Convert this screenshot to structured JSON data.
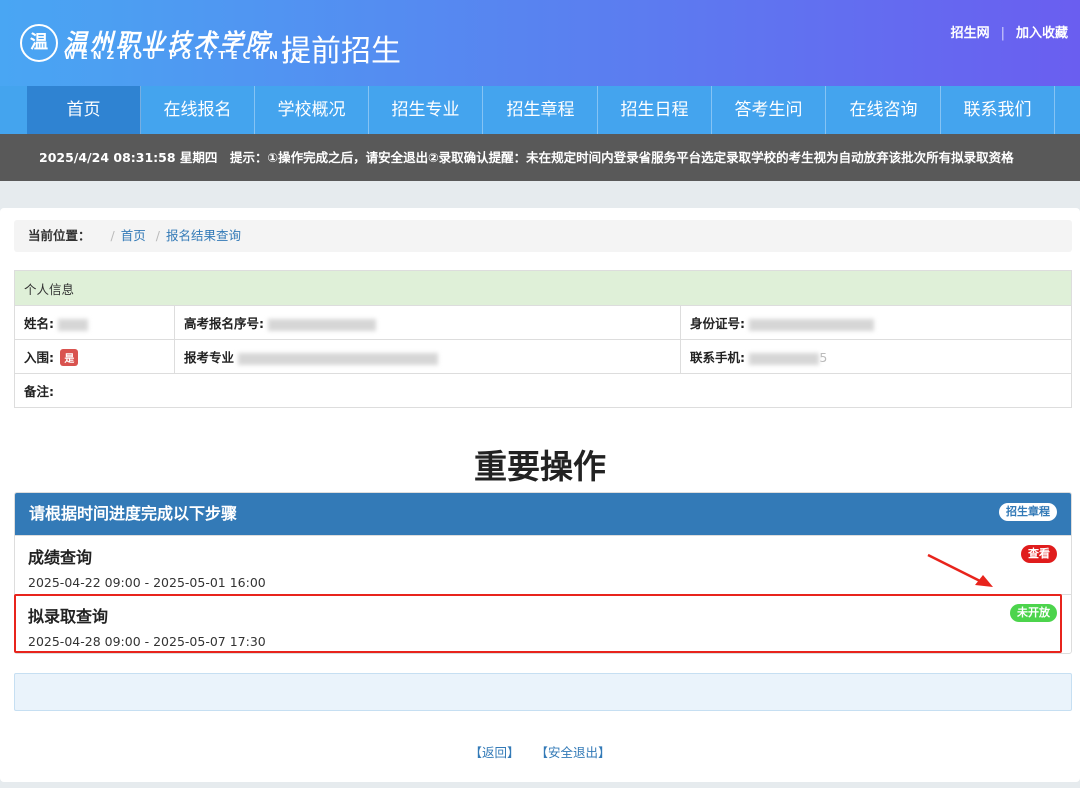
{
  "header": {
    "logo_glyph": "温",
    "school_cn": "温州职业技术学院",
    "school_en": "WENZHOU POLYTECHNIC",
    "site_title": "提前招生",
    "links": [
      "招生网",
      "加入收藏"
    ],
    "link_separator": "|"
  },
  "nav": [
    "首页",
    "在线报名",
    "学校概况",
    "招生专业",
    "招生章程",
    "招生日程",
    "答考生问",
    "在线咨询",
    "联系我们"
  ],
  "notice": {
    "datetime": "2025/4/24 08:31:58 星期四",
    "tip": "提示：①操作完成之后，请安全退出②录取确认提醒：未在规定时间内登录省服务平台选定录取学校的考生视为自动放弃该批次所有拟录取资格"
  },
  "breadcrumb": {
    "label": "当前位置：",
    "separator": "/",
    "items": [
      "首页",
      "报名结果查询"
    ]
  },
  "info": {
    "section": "个人信息",
    "name_label": "姓名:",
    "exam_no_label": "高考报名序号:",
    "id_label": "身份证号:",
    "selected_label": "入围:",
    "selected_value": "是",
    "major_label": "报考专业",
    "phone_label": "联系手机:",
    "phone_tail": "5",
    "remark_label": "备注:"
  },
  "main_title": "重要操作",
  "steps": {
    "header": "请根据时间进度完成以下步骤",
    "header_badge": "招生章程",
    "items": [
      {
        "name": "成绩查询",
        "time": "2025-04-22 09:00 - 2025-05-01 16:00",
        "badge": "查看"
      },
      {
        "name": "拟录取查询",
        "time": "2025-04-28 09:00 - 2025-05-07 17:30",
        "badge": "未开放"
      }
    ]
  },
  "footer": [
    "【返回】",
    "【安全退出】"
  ],
  "colors": {
    "primary": "#337ab7",
    "nav": "#44a4ee",
    "highlight": "#e8241c",
    "badge_green": "#4cd44c",
    "badge_red": "#e01c1c"
  }
}
